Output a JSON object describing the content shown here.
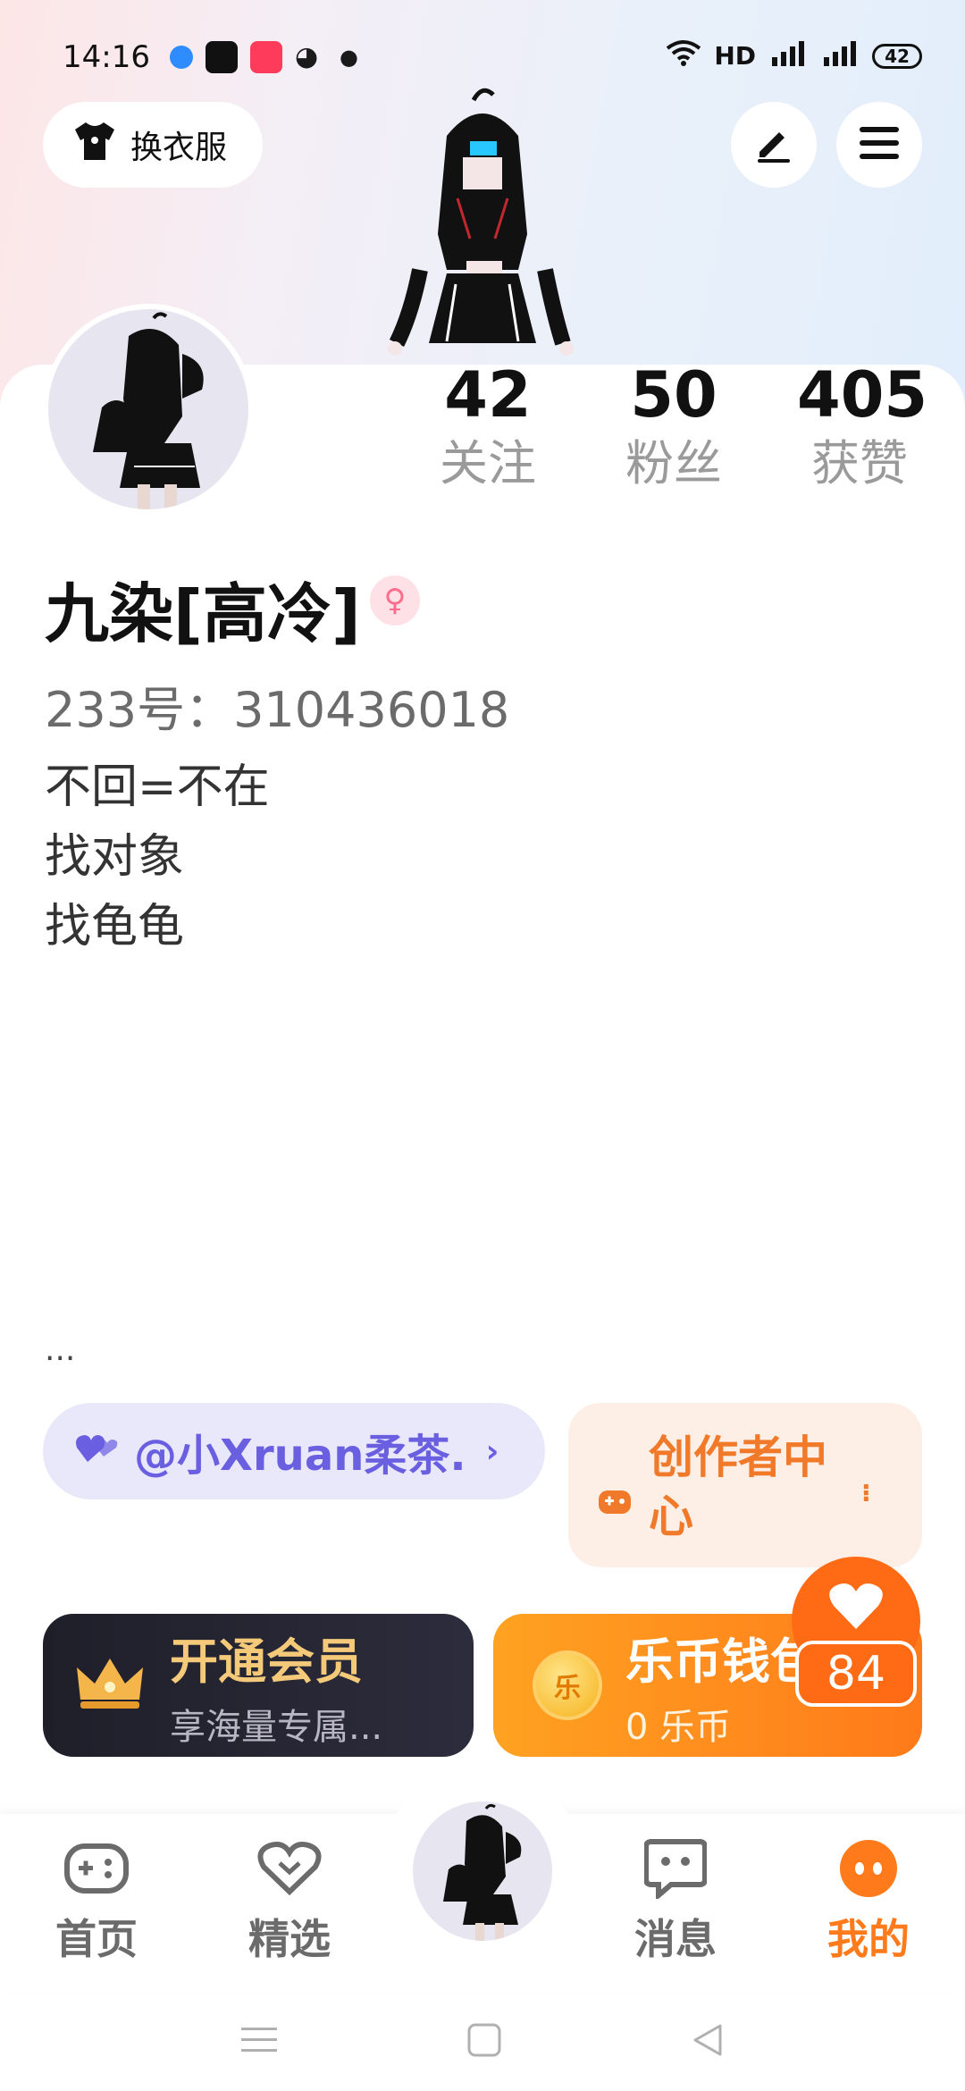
{
  "status_bar": {
    "time": "14:16",
    "network": "HD",
    "battery": "42"
  },
  "header": {
    "outfit_label": "换衣服"
  },
  "stats": [
    {
      "value": "42",
      "label": "关注"
    },
    {
      "value": "50",
      "label": "粉丝"
    },
    {
      "value": "405",
      "label": "获赞"
    }
  ],
  "profile": {
    "name": "九染[高冷]",
    "id_text": "233号：310436018",
    "bio": [
      "不回=不在",
      "找对象",
      "找龟龟"
    ],
    "more": "..."
  },
  "cards": {
    "link_text": "@小Xruan柔茶.",
    "creator_text": "创作者中心",
    "vip_title": "开通会员",
    "vip_sub": "享海量专属...",
    "wallet_title": "乐币钱包",
    "wallet_sub": "0 乐币",
    "coin_glyph": "乐"
  },
  "likes": {
    "count": "84"
  },
  "nav": [
    {
      "label": "首页",
      "icon": "gamepad-icon"
    },
    {
      "label": "精选",
      "icon": "heart-badge-icon"
    },
    {
      "label": "消息",
      "icon": "chat-icon"
    },
    {
      "label": "我的",
      "icon": "profile-dots-icon"
    }
  ],
  "colors": {
    "accent": "#ff7a1a",
    "link": "#6a5fe0",
    "vip_gold": "#f4c97a"
  }
}
